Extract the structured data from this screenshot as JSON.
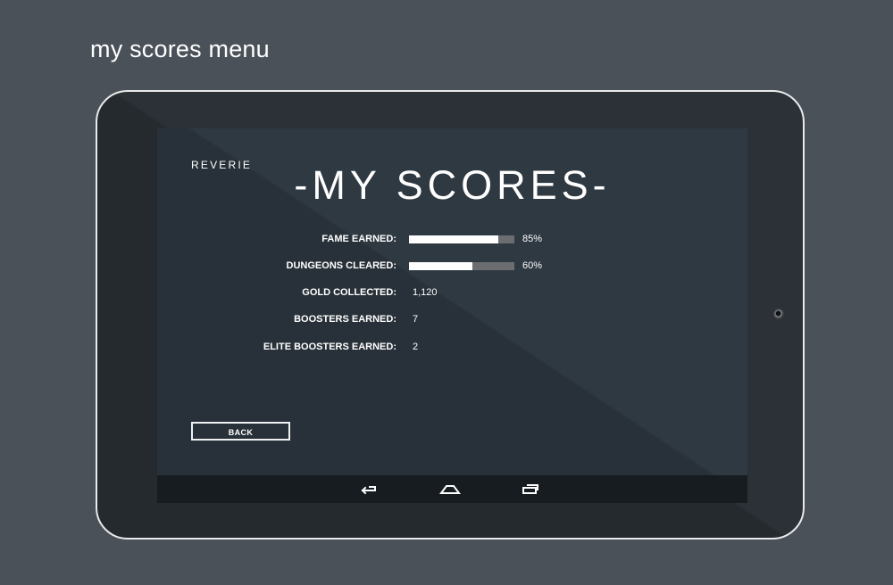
{
  "caption": "my scores menu",
  "app": {
    "brand": "REVERIE",
    "title": "-MY SCORES-"
  },
  "stats": [
    {
      "label": "FAME EARNED:",
      "type": "bar",
      "percent": 85,
      "percent_text": "85%"
    },
    {
      "label": "DUNGEONS CLEARED:",
      "type": "bar",
      "percent": 60,
      "percent_text": "60%"
    },
    {
      "label": "GOLD COLLECTED:",
      "type": "value",
      "value": "1,120"
    },
    {
      "label": "BOOSTERS EARNED:",
      "type": "value",
      "value": "7"
    },
    {
      "label": "ELITE BOOSTERS EARNED:",
      "type": "value",
      "value": "2"
    }
  ],
  "buttons": {
    "back": "BACK"
  },
  "system_nav": {
    "icons": [
      "back-icon",
      "home-icon",
      "recent-apps-icon"
    ]
  },
  "colors": {
    "background": "#4a5159",
    "tablet_bezel": "#2b3137",
    "screen": "#2f3942",
    "nav_bar": "#161c20",
    "bar_track": "#6b6d70",
    "bar_fill": "#ffffff",
    "text": "#ffffff"
  }
}
